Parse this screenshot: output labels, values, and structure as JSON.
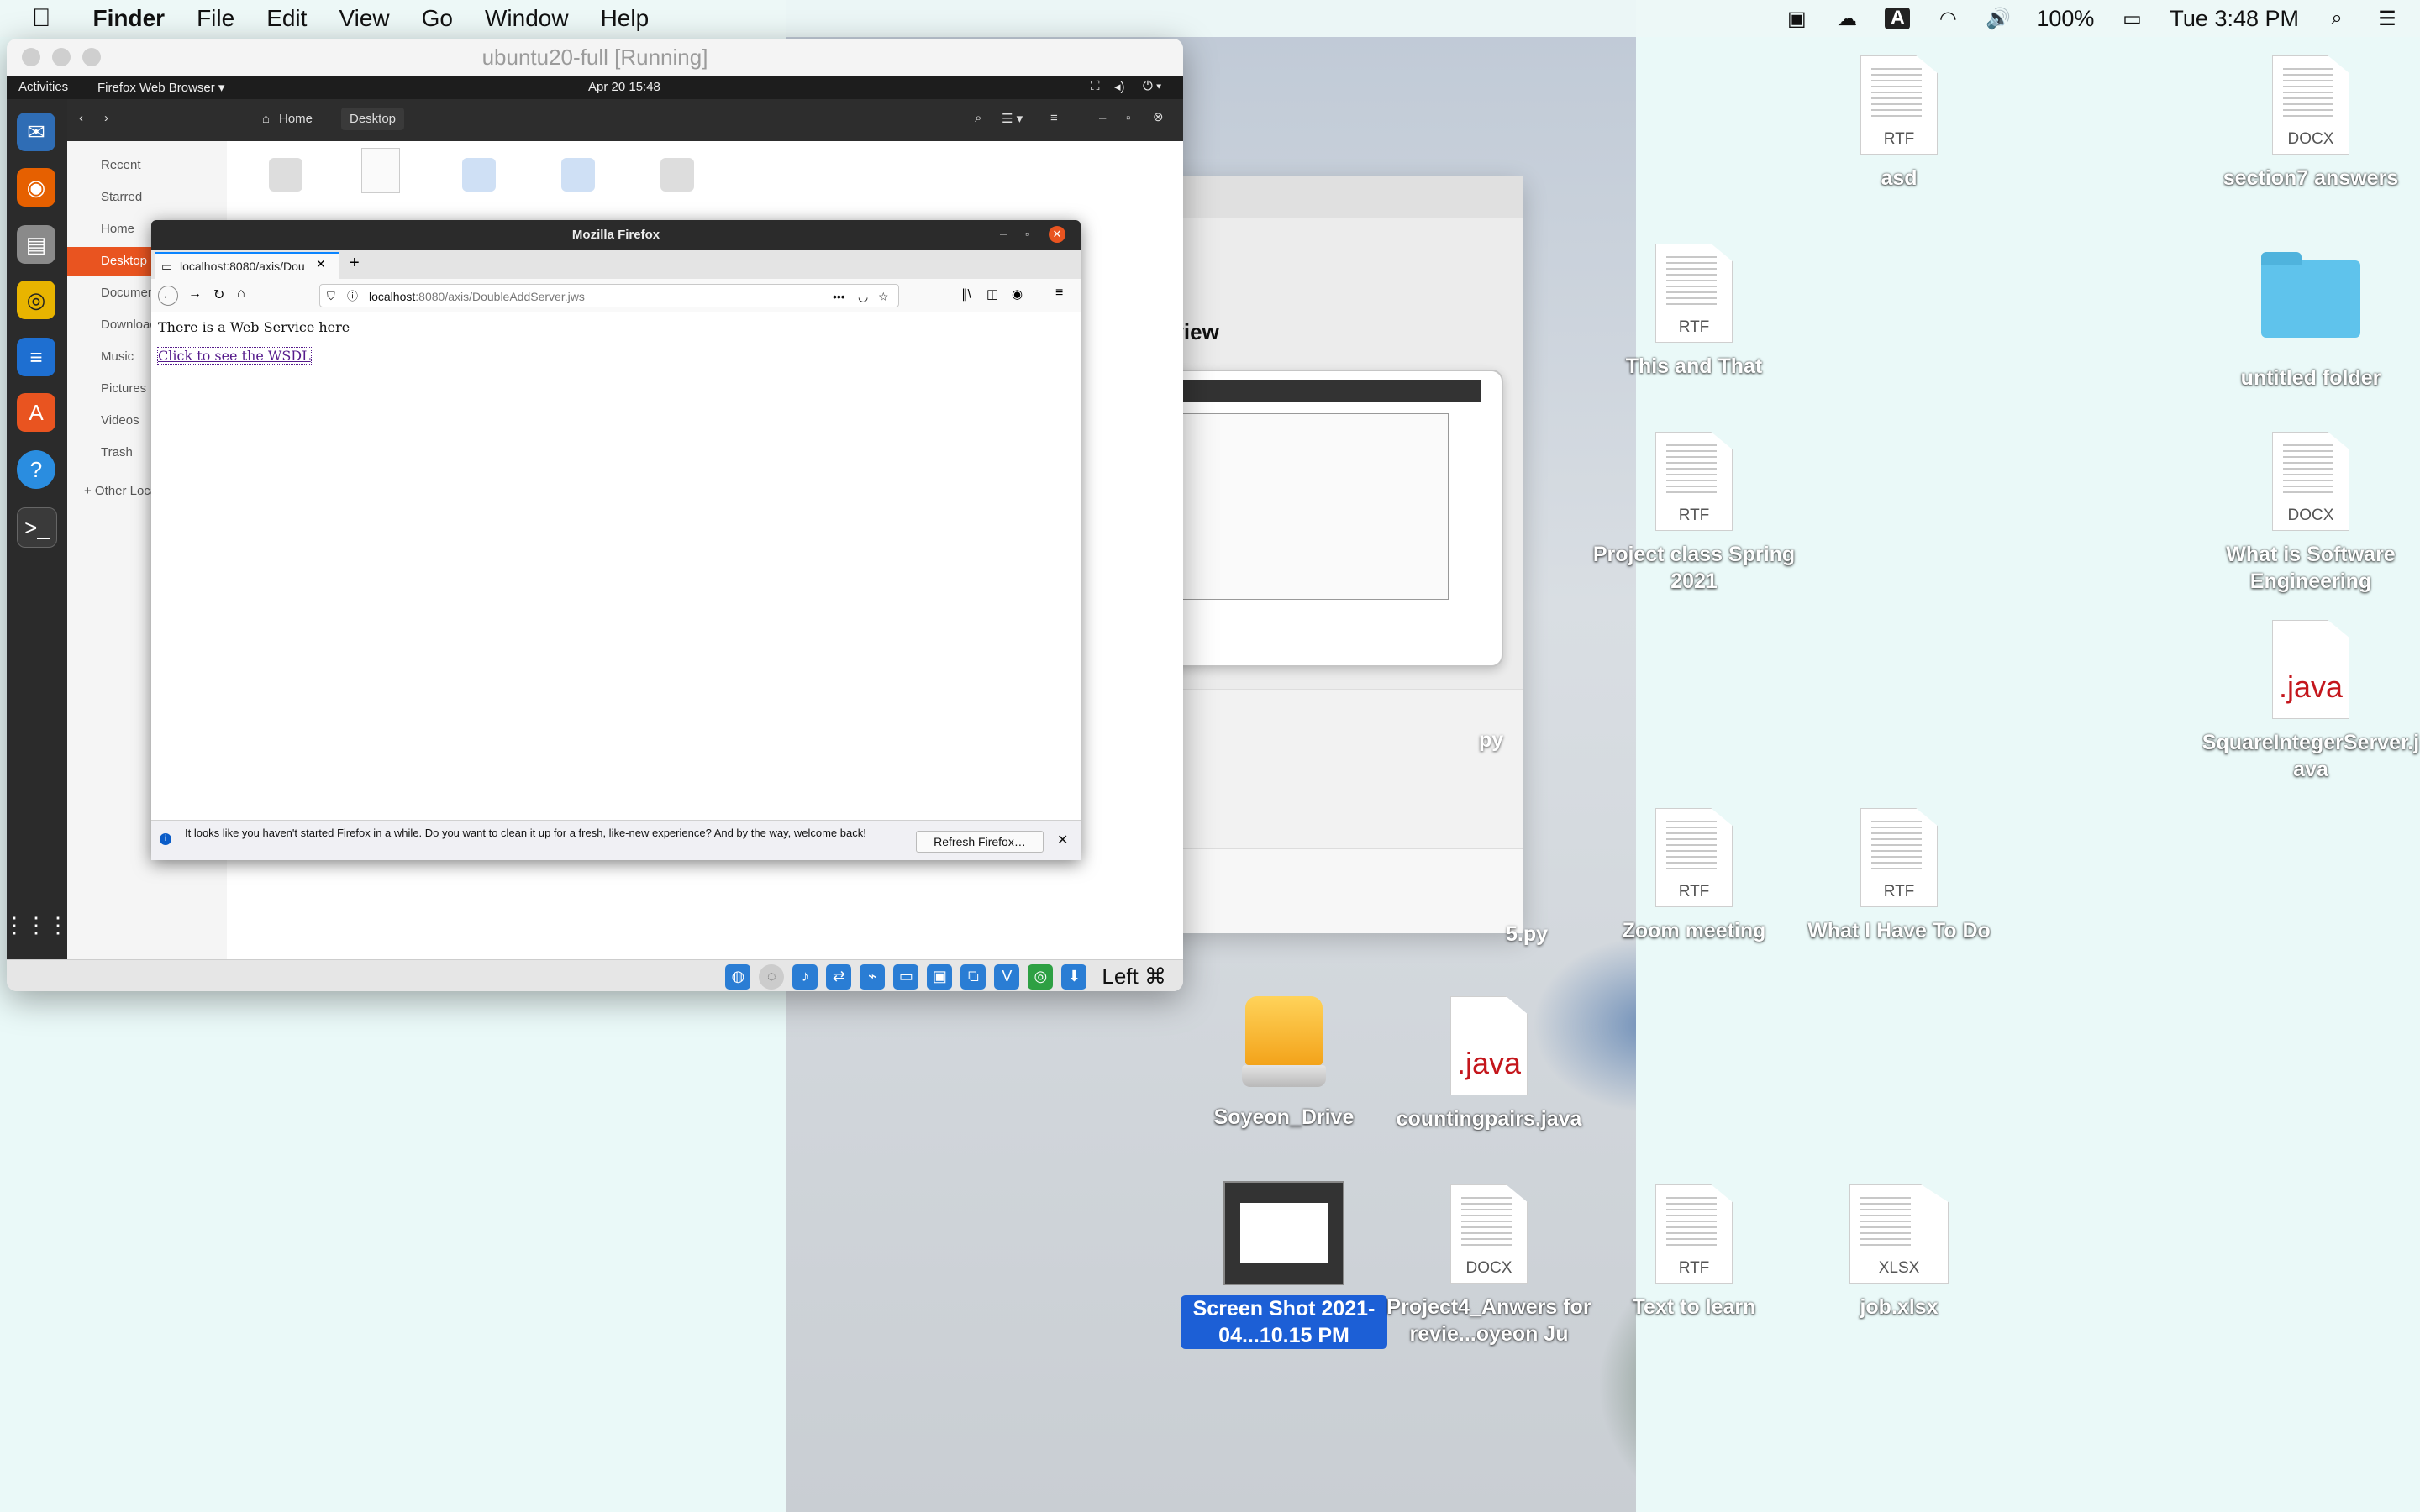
{
  "menubar": {
    "app": "Finder",
    "items": [
      "File",
      "Edit",
      "View",
      "Go",
      "Window",
      "Help"
    ],
    "battery": "100%",
    "clock": "Tue 3:48 PM",
    "tray_letter": "A"
  },
  "vbox": {
    "title": "ubuntu20-full [Running]",
    "host_key": "Left ⌘"
  },
  "gnome": {
    "activities": "Activities",
    "app_menu": "Firefox Web Browser ▾",
    "clock": "Apr 20  15:48"
  },
  "nautilus": {
    "path_home": "Home",
    "path_desktop": "Desktop",
    "sidebar": [
      "Recent",
      "Starred",
      "Home",
      "Desktop",
      "Documents",
      "Downloads",
      "Music",
      "Pictures",
      "Videos",
      "Trash",
      "+ Other Locations"
    ]
  },
  "firefox": {
    "window_title": "Mozilla Firefox",
    "tab_title": "localhost:8080/axis/Dou",
    "url_host": "localhost",
    "url_rest": ":8080/axis/DoubleAddServer.jws",
    "page_text": "There is a Web Service here",
    "page_link": "Click to see the WSDL",
    "notification": "It looks like you haven't started Firefox in a while. Do you want to clean it up for a fresh, like-new experience? And by the way, welcome back!",
    "refresh_button": "Refresh Firefox…"
  },
  "quicklook": {
    "heading_fragment": "eview",
    "fragment_py1": "py",
    "fragment_py2": "5.py"
  },
  "desktop_icons": [
    {
      "label": "asd",
      "type": "RTF"
    },
    {
      "label": "section7 answers",
      "type": "DOCX"
    },
    {
      "label": "This and That",
      "type": "RTF"
    },
    {
      "label": "untitled folder",
      "type": "folder"
    },
    {
      "label": "Project class Spring 2021",
      "type": "RTF"
    },
    {
      "label": "What is Software Engineering",
      "type": "DOCX"
    },
    {
      "label": "SquareIntegerServer.java",
      "type": ".java"
    },
    {
      "label": "Zoom meeting",
      "type": "RTF"
    },
    {
      "label": "What I Have To Do",
      "type": "RTF"
    },
    {
      "label": "Soyeon_Drive",
      "type": "drive"
    },
    {
      "label": "countingpairs.java",
      "type": ".java"
    },
    {
      "label": "Screen Shot 2021-04...10.15 PM",
      "type": "screenshot"
    },
    {
      "label": "Project4_Anwers for revie...oyeon Ju",
      "type": "DOCX"
    },
    {
      "label": "Text to learn",
      "type": "RTF"
    },
    {
      "label": "job.xlsx",
      "type": "XLSX"
    }
  ],
  "colors": {
    "ubuntu_orange": "#e95420",
    "selection_blue": "#1c5fd6",
    "folder_blue": "#5fc3ec"
  }
}
